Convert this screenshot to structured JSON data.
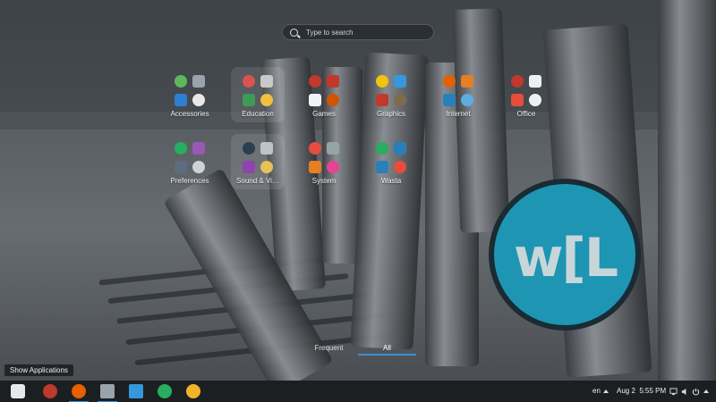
{
  "search": {
    "placeholder": "Type to search"
  },
  "folders": [
    {
      "label": "Accessories",
      "icons": [
        "calculator-icon",
        "archive-manager-icon",
        "search-files-icon",
        "notes-icon"
      ],
      "colors": [
        "#5cb85c",
        "#9aa3ab",
        "#2f7fd0",
        "#e8e8e8"
      ]
    },
    {
      "label": "Education",
      "icons": [
        "marble-globe-icon",
        "lectern-icon",
        "gcompris-icon",
        "yellow-book-icon"
      ],
      "colors": [
        "#d9534f",
        "#c9c9c9",
        "#3d9b57",
        "#f0c040"
      ]
    },
    {
      "label": "Games",
      "icons": [
        "aisleriot-icon",
        "bible-icon",
        "mahjongg-icon",
        "lifebuoy-icon"
      ],
      "colors": [
        "#c0392b",
        "#c0392b",
        "#f2f2f2",
        "#d35400"
      ]
    },
    {
      "label": "Graphics",
      "icons": [
        "inkscape-pen-icon",
        "shotwell-icon",
        "document-scanner-icon",
        "gimp-icon"
      ],
      "colors": [
        "#f1c40f",
        "#3498db",
        "#c0392b",
        "#7f6b4b"
      ]
    },
    {
      "label": "Internet",
      "icons": [
        "firefox-icon",
        "bird-icon",
        "remote-desktop-icon",
        "chat-icon"
      ],
      "colors": [
        "#e66000",
        "#e67e22",
        "#2980b9",
        "#5dade2"
      ]
    },
    {
      "label": "Office",
      "icons": [
        "writer-icon",
        "calendar-icon",
        "document-viewer-icon",
        "presentation-icon"
      ],
      "colors": [
        "#c0392b",
        "#ecf0f1",
        "#e74c3c",
        "#ecf0f1"
      ]
    },
    {
      "label": "Preferences",
      "icons": [
        "network-icon",
        "theme-icon",
        "shield-icon",
        "keyboard-icon"
      ],
      "colors": [
        "#27ae60",
        "#9b59b6",
        "#5d6d7e",
        "#cfd2d5"
      ]
    },
    {
      "label": "Sound & Vi…",
      "icons": [
        "vlc-icon",
        "disc-burner-icon",
        "video-editor-icon",
        "sound-recorder-icon"
      ],
      "colors": [
        "#2c3e50",
        "#bdc3c7",
        "#8e44ad",
        "#e6c15a"
      ]
    },
    {
      "label": "System",
      "icons": [
        "system-settings-icon",
        "software-manager-icon",
        "gear-icon",
        "debian-icon"
      ],
      "colors": [
        "#e74c3c",
        "#95a5a6",
        "#e67e22",
        "#e84393"
      ]
    },
    {
      "label": "Wasta",
      "icons": [
        "wasta-icon-1",
        "wasta-icon-2",
        "wasta-icon-3",
        "wasta-icon-4"
      ],
      "colors": [
        "#27ae60",
        "#2980b9",
        "#2980b9",
        "#e74c3c"
      ]
    }
  ],
  "views": {
    "frequent_label": "Frequent",
    "all_label": "All"
  },
  "tooltip": "Show Applications",
  "dock": [
    {
      "name": "show-applications-icon",
      "color": "#e8e8e8"
    },
    {
      "name": "power-shutdown-icon",
      "color": "#c0392b"
    },
    {
      "name": "firefox-icon",
      "color": "#e66000"
    },
    {
      "name": "files-icon",
      "color": "#9aa3ab"
    },
    {
      "name": "document-icon",
      "color": "#3498db"
    },
    {
      "name": "wasta-green-icon",
      "color": "#27ae60"
    },
    {
      "name": "wasta-yellow-icon",
      "color": "#f0b429"
    }
  ],
  "tray": {
    "keyboard_layout": "en",
    "date": "Aug 2",
    "time": "5:55 PM"
  }
}
